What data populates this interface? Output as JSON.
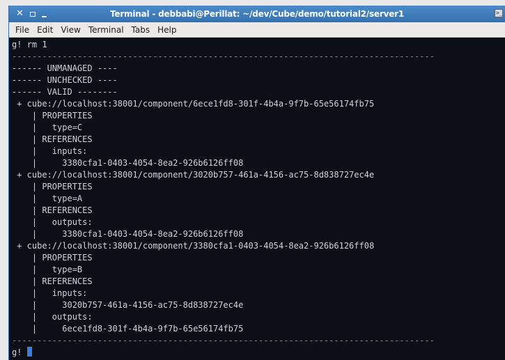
{
  "window": {
    "title": "Terminal - debbabi@Perillat: ~/dev/Cube/demo/tutorial2/server1",
    "controls": [
      "close-icon",
      "maximize-icon",
      "minimize-icon"
    ],
    "title_icon": "terminal-icon"
  },
  "menu": {
    "items": [
      {
        "label": "File"
      },
      {
        "label": "Edit"
      },
      {
        "label": "View"
      },
      {
        "label": "Terminal"
      },
      {
        "label": "Tabs"
      },
      {
        "label": "Help"
      }
    ]
  },
  "terminal": {
    "lines": [
      "g! rm 1",
      "------------------------------------------------------------------------------------",
      "------ UNMANAGED ----",
      "------ UNCHECKED ----",
      "------ VALID --------",
      " + cube://localhost:38001/component/6ece1fd8-301f-4b4a-9f7b-65e56174fb75",
      "    | PROPERTIES",
      "    |   type=C",
      "    | REFERENCES",
      "    |   inputs:",
      "    |     3380cfa1-0403-4054-8ea2-926b6126ff08",
      " + cube://localhost:38001/component/3020b757-461a-4156-ac75-8d838727ec4e",
      "    | PROPERTIES",
      "    |   type=A",
      "    | REFERENCES",
      "    |   outputs:",
      "    |     3380cfa1-0403-4054-8ea2-926b6126ff08",
      " + cube://localhost:38001/component/3380cfa1-0403-4054-8ea2-926b6126ff08",
      "    | PROPERTIES",
      "    |   type=B",
      "    | REFERENCES",
      "    |   inputs:",
      "    |     3020b757-461a-4156-ac75-8d838727ec4e",
      "    |   outputs:",
      "    |     6ece1fd8-301f-4b4a-9f7b-65e56174fb75",
      "------------------------------------------------------------------------------------"
    ],
    "prompt": "g! "
  },
  "colors": {
    "titlebar": "#3f7cbc",
    "terminal_bg": "#0c1016",
    "terminal_fg": "#cfd3d8",
    "cursor": "#3d7fd6",
    "menubar": "#eceae6"
  }
}
